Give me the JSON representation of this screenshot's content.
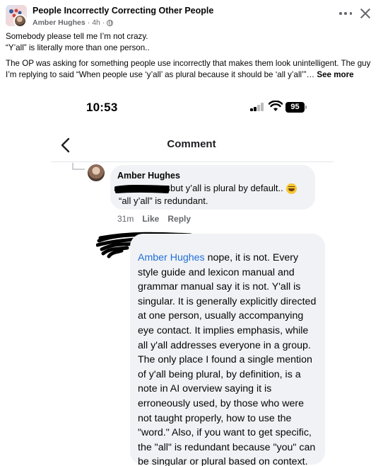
{
  "post": {
    "group_name": "People Incorrectly Correcting Other People",
    "author": "Amber Hughes",
    "time": "4h",
    "dot": "·",
    "icons": {
      "group": "group-avatar",
      "privacy": "globe-icon",
      "more": "more-icon",
      "close": "close-icon"
    },
    "text_line1": "Somebody please tell me I’m not crazy.",
    "text_line2": "“Y’all” is literally more than one person..",
    "text_paragraph2": "The OP was asking for something people use incorrectly that makes them look unintelligent. The guy I’m replying to said “When people use ‘y’all’ as plural because it should be ‘all y’all’”…",
    "see_more": "See more"
  },
  "screenshot": {
    "status_bar": {
      "time": "10:53",
      "battery": "95"
    },
    "nav": {
      "title": "Comment"
    },
    "comment1": {
      "name": "Amber Hughes",
      "text_line1": "but y’all is plural by default..",
      "text_line2": "“all y’all” is redundant.",
      "age": "31m",
      "like_label": "Like",
      "reply_label": "Reply"
    },
    "comment2": {
      "mention": "Amber Hughes",
      "text": " nope, it is not. Every style guide and lexicon manual and grammar manual say it is not. Y'all is singular. It is generally explicitly directed at one person, usually accompanying eye contact. It implies emphasis, while all y'all addresses everyone in a group. The only place I found a single mention of y'all being plural, by definition, is a note in AI overview saying it is erroneously used, by those who were not taught properly, how to use the \"word.\" Also, if you want to get specific, the \"all\" is redundant because \"you\" can be singular or plural based on context. So it is STILL wrong."
    }
  }
}
